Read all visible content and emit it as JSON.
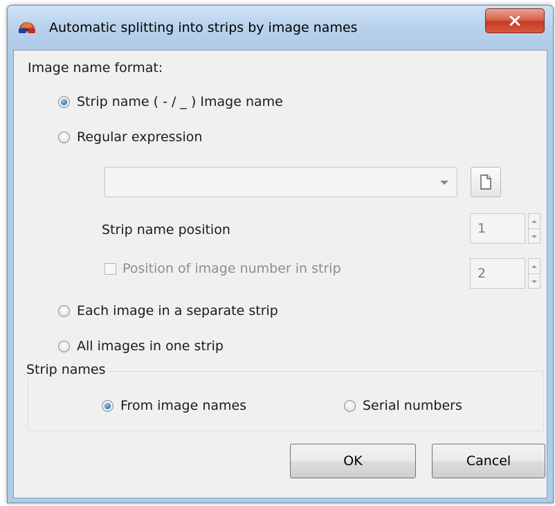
{
  "window": {
    "title": "Automatic splitting into strips by image names",
    "close_label": "✕"
  },
  "format": {
    "heading": "Image name format:",
    "options": [
      {
        "label": "Strip name ( - / _ ) Image name",
        "checked": true
      },
      {
        "label": "Regular expression",
        "checked": false
      },
      {
        "label": "Each image in a separate strip",
        "checked": false
      },
      {
        "label": "All images in one strip",
        "checked": false
      }
    ]
  },
  "regex": {
    "combo_value": "",
    "strip_name_position_label": "Strip name position",
    "strip_name_position_value": "1",
    "image_number_label": "Position of image number in strip",
    "image_number_checked": false,
    "image_number_value": "2"
  },
  "strip_names": {
    "legend": "Strip names",
    "options": [
      {
        "label": "From image names",
        "checked": true
      },
      {
        "label": "Serial numbers",
        "checked": false
      }
    ]
  },
  "buttons": {
    "ok_label": "OK",
    "cancel_label": "Cancel"
  },
  "icons": {
    "app": "3d-glasses-icon",
    "close": "close-icon",
    "browse": "document-icon",
    "dropdown": "chevron-down-icon"
  }
}
